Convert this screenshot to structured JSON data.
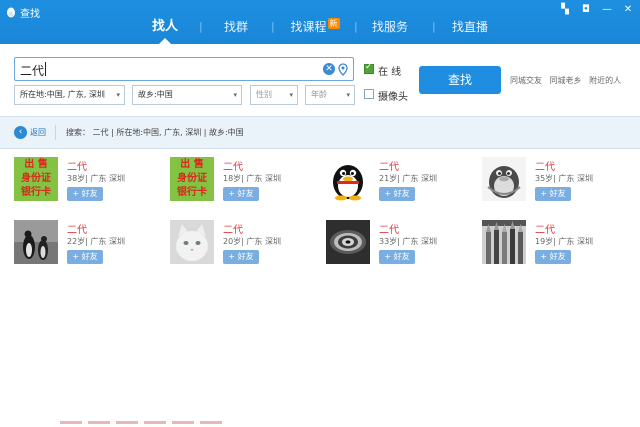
{
  "window": {
    "title": "查找",
    "colors": {
      "titlebar": "#1a86d8",
      "accent": "#1f8ee0",
      "name_red": "#e2383a",
      "new_badge": "#ff8a00"
    },
    "controls": [
      "menu-icon",
      "skin-icon",
      "minimize-icon",
      "close-icon"
    ]
  },
  "tabs": [
    {
      "label": "找人",
      "active": true
    },
    {
      "label": "找群"
    },
    {
      "label": "找课程",
      "badge": "新"
    },
    {
      "label": "找服务"
    },
    {
      "label": "找直播"
    }
  ],
  "search": {
    "value": "二代",
    "online_label": "在 线",
    "online_checked": true,
    "camera_label": "摄像头",
    "camera_checked": false,
    "find_label": "查找",
    "quick_links": [
      "同城交友",
      "同城老乡",
      "附近的人"
    ],
    "filters": {
      "location": "所在地:中国, 广东, 深圳",
      "hometown": "故乡:中国",
      "gender": "性别",
      "age": "年龄"
    }
  },
  "breadcrumb": {
    "back_label": "返回",
    "text": "搜索： 二代 | 所在地:中国, 广东, 深圳 | 故乡:中国"
  },
  "results": [
    {
      "name": "二代",
      "age_loc": "38岁| 广东 深圳",
      "add": "+ 好友",
      "avatar": "text-ad",
      "avatar_text": [
        "出 售",
        "身份证",
        "银行卡"
      ]
    },
    {
      "name": "二代",
      "age_loc": "18岁| 广东 深圳",
      "add": "+ 好友",
      "avatar": "text-ad",
      "avatar_text": [
        "出 售",
        "身份证",
        "银行卡"
      ]
    },
    {
      "name": "二代",
      "age_loc": "21岁| 广东 深圳",
      "add": "+ 好友",
      "avatar": "penguin-icon"
    },
    {
      "name": "二代",
      "age_loc": "35岁| 广东 深圳",
      "add": "+ 好友",
      "avatar": "penguin-grayscale-icon"
    },
    {
      "name": "二代",
      "age_loc": "22岁| 广东 深圳",
      "add": "+ 好友",
      "avatar": "penguins-photo"
    },
    {
      "name": "二代",
      "age_loc": "20岁| 广东 深圳",
      "add": "+ 好友",
      "avatar": "cat-photo"
    },
    {
      "name": "二代",
      "age_loc": "33岁| 广东 深圳",
      "add": "+ 好友",
      "avatar": "spiral-photo"
    },
    {
      "name": "二代",
      "age_loc": "19岁| 广东 深圳",
      "add": "+ 好友",
      "avatar": "pencils-photo"
    }
  ]
}
